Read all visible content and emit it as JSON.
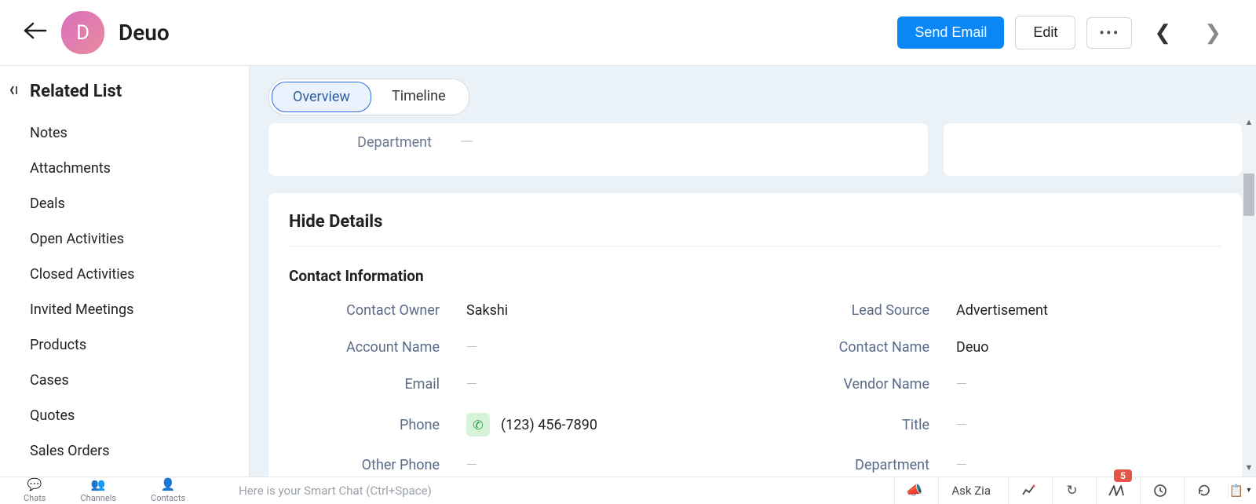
{
  "header": {
    "avatar_initial": "D",
    "title": "Deuo",
    "send_email_label": "Send Email",
    "edit_label": "Edit"
  },
  "sidebar": {
    "title": "Related List",
    "items": [
      {
        "label": "Notes"
      },
      {
        "label": "Attachments"
      },
      {
        "label": "Deals"
      },
      {
        "label": "Open Activities"
      },
      {
        "label": "Closed Activities"
      },
      {
        "label": "Invited Meetings"
      },
      {
        "label": "Products"
      },
      {
        "label": "Cases"
      },
      {
        "label": "Quotes"
      },
      {
        "label": "Sales Orders"
      }
    ]
  },
  "tabs": {
    "overview": "Overview",
    "timeline": "Timeline"
  },
  "top_card": {
    "department_label": "Department",
    "department_value": "—"
  },
  "details": {
    "hide_label": "Hide Details",
    "section_title": "Contact Information",
    "rows": [
      {
        "left_label": "Contact Owner",
        "left_value": "Sakshi",
        "right_label": "Lead Source",
        "right_value": "Advertisement"
      },
      {
        "left_label": "Account Name",
        "left_value": "—",
        "right_label": "Contact Name",
        "right_value": "Deuo"
      },
      {
        "left_label": "Email",
        "left_value": "—",
        "right_label": "Vendor Name",
        "right_value": "—"
      },
      {
        "left_label": "Phone",
        "left_value": "(123) 456-7890",
        "right_label": "Title",
        "right_value": "—",
        "phone": true
      },
      {
        "left_label": "Other Phone",
        "left_value": "—",
        "right_label": "Department",
        "right_value": "—"
      }
    ]
  },
  "footer": {
    "tabs": [
      {
        "label": "Chats",
        "icon": "●"
      },
      {
        "label": "Channels",
        "icon": "⛬"
      },
      {
        "label": "Contacts",
        "icon": "👤"
      }
    ],
    "smart_chat_placeholder": "Here is your Smart Chat (Ctrl+Space)",
    "ask_zia_label": "Ask Zia",
    "badge": "5"
  }
}
